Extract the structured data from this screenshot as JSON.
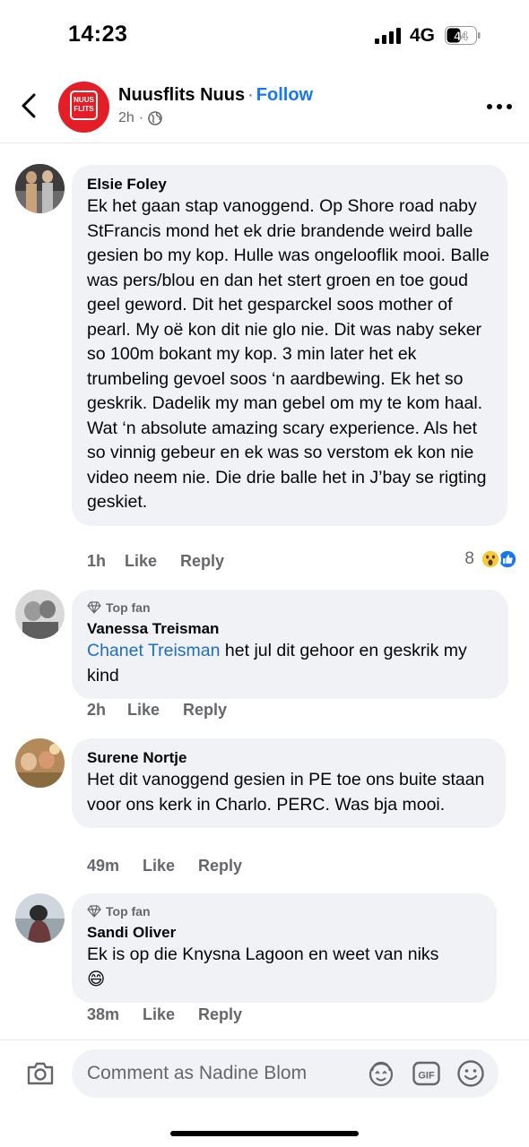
{
  "status_bar": {
    "time": "14:23",
    "network": "4G",
    "battery": "44"
  },
  "header": {
    "page_name": "Nuusflits Nuus",
    "separator": "·",
    "follow_label": "Follow",
    "post_age": "2h",
    "logo_text_1": "NUUS",
    "logo_text_2": "FLITS"
  },
  "comments": [
    {
      "author": "Elsie Foley",
      "text": "Ek het gaan stap vanoggend. Op Shore road naby StFrancis mond het ek drie brandende weird balle gesien bo my kop. Hulle was ongelooflik mooi. Balle was pers/blou en dan het stert groen en toe goud geel geword. Dit het gesparckel soos mother of pearl. My oë kon dit nie glo nie. Dit was naby seker so 100m bokant my kop. 3 min later het ek trumbeling gevoel soos ‘n aardbewing. Ek het so geskrik. Dadelik my man gebel om my te kom haal. Wat ‘n absolute amazing scary experience. Als het so vinnig gebeur en ek was so verstom ek kon nie video neem nie. Die drie balle het in J’bay se rigting geskiet.",
      "time": "1h",
      "like_label": "Like",
      "reply_label": "Reply",
      "reaction_count": "8"
    },
    {
      "badge": "Top fan",
      "author": "Vanessa Treisman",
      "mention": "Chanet Treisman",
      "text": " het jul dit gehoor en geskrik my kind",
      "time": "2h",
      "like_label": "Like",
      "reply_label": "Reply"
    },
    {
      "author": "Surene Nortje",
      "text": "Het dit vanoggend gesien in PE  toe ons buite staan voor ons kerk in Charlo. PERC.  Was bja mooi.",
      "time": "49m",
      "like_label": "Like",
      "reply_label": "Reply"
    },
    {
      "badge": "Top fan",
      "author": "Sandi Oliver",
      "text": "Ek is op die Knysna Lagoon en weet van niks",
      "emoji": "😄",
      "time": "38m",
      "like_label": "Like",
      "reply_label": "Reply"
    }
  ],
  "composer": {
    "placeholder": "Comment as Nadine Blom",
    "gif_label": "GIF"
  },
  "colors": {
    "accent": "#1877f2",
    "bubble": "#f0f2f5",
    "secondary_text": "#65676b",
    "brand_red": "#e41e26"
  }
}
